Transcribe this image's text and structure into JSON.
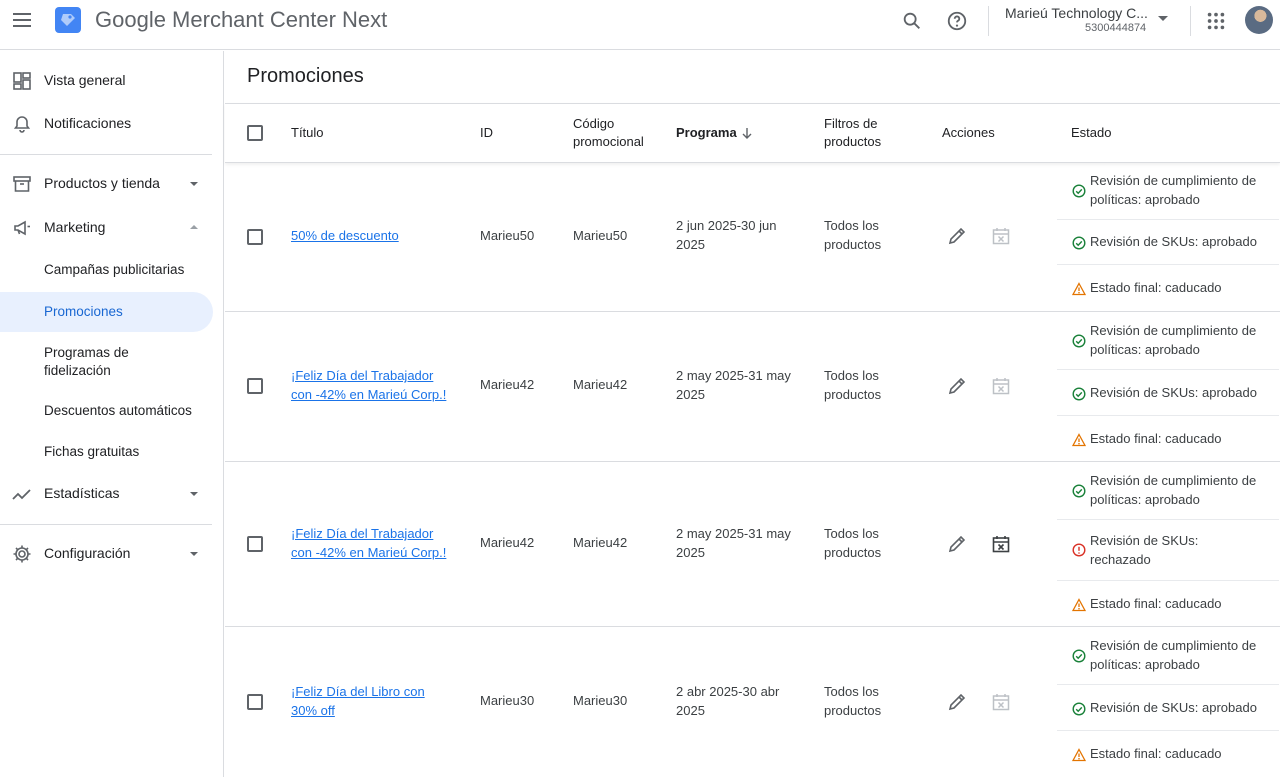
{
  "app": {
    "title": "Google Merchant Center Next",
    "account_name": "Marieú Technology C...",
    "account_id": "5300444874"
  },
  "sidebar": {
    "items": [
      {
        "label": "Vista general"
      },
      {
        "label": "Notificaciones"
      },
      {
        "label": "Productos y tienda"
      },
      {
        "label": "Marketing"
      },
      {
        "label": "Campañas publicitarias"
      },
      {
        "label": "Promociones"
      },
      {
        "label": "Programas de fidelización"
      },
      {
        "label": "Descuentos automáticos"
      },
      {
        "label": "Fichas gratuitas"
      },
      {
        "label": "Estadísticas"
      },
      {
        "label": "Configuración"
      }
    ]
  },
  "page": {
    "title": "Promociones"
  },
  "table": {
    "headers": {
      "title": "Título",
      "id": "ID",
      "code": "Código promocional",
      "schedule": "Programa",
      "filters": "Filtros de productos",
      "actions": "Acciones",
      "status": "Estado"
    },
    "rows": [
      {
        "title": "50% de descuento",
        "id": "Marieu50",
        "code": "Marieu50",
        "schedule": "2 jun 2025-30 jun 2025",
        "filters": "Todos los productos",
        "statuses": [
          {
            "type": "ok",
            "text": "Revisión de cumplimiento de políticas: aprobado"
          },
          {
            "type": "ok",
            "text": "Revisión de SKUs: aprobado"
          },
          {
            "type": "warn",
            "text": "Estado final: caducado"
          }
        ]
      },
      {
        "title": "¡Feliz Día del Trabajador con -42% en Marieú Corp.!",
        "id": "Marieu42",
        "code": "Marieu42",
        "schedule": "2 may 2025-31 may 2025",
        "filters": "Todos los productos",
        "statuses": [
          {
            "type": "ok",
            "text": "Revisión de cumplimiento de políticas: aprobado"
          },
          {
            "type": "ok",
            "text": "Revisión de SKUs: aprobado"
          },
          {
            "type": "warn",
            "text": "Estado final: caducado"
          }
        ]
      },
      {
        "title": "¡Feliz Día del Trabajador con -42% en Marieú Corp.!",
        "id": "Marieu42",
        "code": "Marieu42",
        "schedule": "2 may 2025-31 may 2025",
        "filters": "Todos los productos",
        "statuses": [
          {
            "type": "ok",
            "text": "Revisión de cumplimiento de políticas: aprobado"
          },
          {
            "type": "error",
            "text": "Revisión de SKUs: rechazado"
          },
          {
            "type": "warn",
            "text": "Estado final: caducado"
          }
        ]
      },
      {
        "title": "¡Feliz Día del Libro con 30% off",
        "id": "Marieu30",
        "code": "Marieu30",
        "schedule": "2 abr 2025-30 abr 2025",
        "filters": "Todos los productos",
        "statuses": [
          {
            "type": "ok",
            "text": "Revisión de cumplimiento de políticas: aprobado"
          },
          {
            "type": "ok",
            "text": "Revisión de SKUs: aprobado"
          },
          {
            "type": "warn",
            "text": "Estado final: caducado"
          }
        ]
      }
    ]
  },
  "colors": {
    "accent": "#1a73e8",
    "ok": "#188038",
    "warn": "#e37400",
    "error": "#d93025",
    "active_nav_bg": "#e8f0fe"
  }
}
